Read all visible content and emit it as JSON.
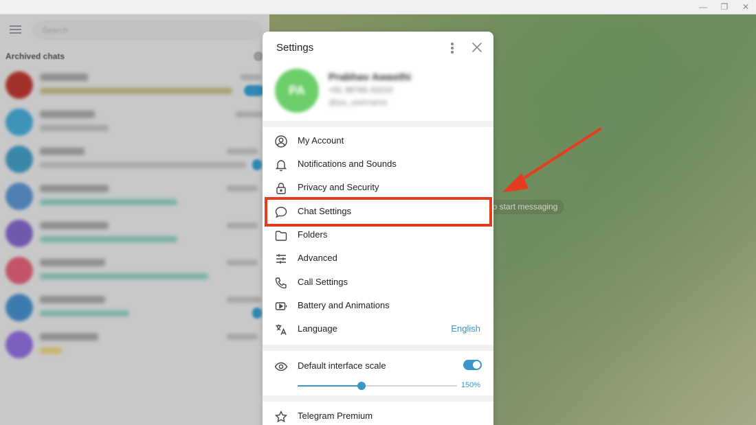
{
  "window": {
    "minimize_glyph": "—",
    "restore_glyph": "❐",
    "close_glyph": "✕"
  },
  "left": {
    "search_placeholder": "Search",
    "archived_title": "Archived chats"
  },
  "right": {
    "start_message": "at to start messaging"
  },
  "dialog": {
    "title": "Settings",
    "profile": {
      "initials": "PA",
      "name": "Prabhav Awasthi",
      "phone": "+91 98765 43210",
      "username": "@pa_username"
    },
    "menu": [
      {
        "label": "My Account",
        "icon": "account-circle-icon"
      },
      {
        "label": "Notifications and Sounds",
        "icon": "bell-icon"
      },
      {
        "label": "Privacy and Security",
        "icon": "lock-icon"
      },
      {
        "label": "Chat Settings",
        "icon": "chat-bubble-icon"
      },
      {
        "label": "Folders",
        "icon": "folder-icon"
      },
      {
        "label": "Advanced",
        "icon": "sliders-icon"
      },
      {
        "label": "Call Settings",
        "icon": "phone-icon"
      },
      {
        "label": "Battery and Animations",
        "icon": "battery-animation-icon"
      },
      {
        "label": "Language",
        "icon": "translate-icon",
        "value": "English"
      }
    ],
    "scale": {
      "label": "Default interface scale",
      "enabled": true,
      "value_text": "150%",
      "slider_fraction": 0.4
    },
    "premium": {
      "label": "Telegram Premium",
      "icon": "star-icon"
    }
  },
  "colors": {
    "accent": "#3a95c9",
    "highlight": "#e53b1e",
    "arrow": "#e53b1e"
  }
}
